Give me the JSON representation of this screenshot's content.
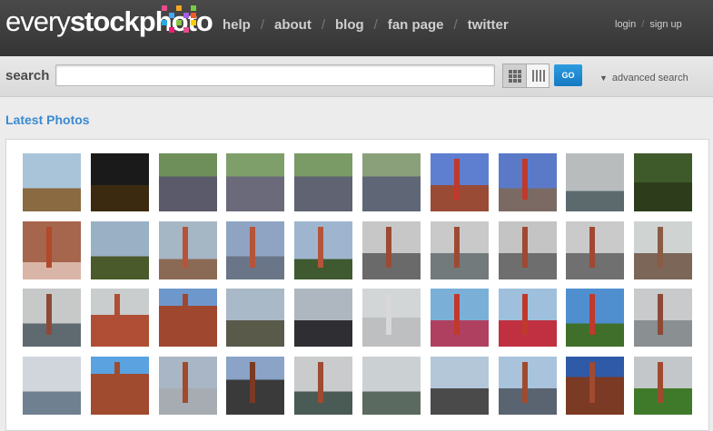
{
  "logo": {
    "light": "every",
    "bold": "stockphoto"
  },
  "nav": {
    "items": [
      "help",
      "about",
      "blog",
      "fan page",
      "twitter"
    ],
    "separator": "/"
  },
  "auth": {
    "login": "login",
    "signup": "sign up",
    "separator": "/"
  },
  "search": {
    "label": "search",
    "value": "",
    "placeholder": "",
    "go_label": "GO",
    "advanced_label": "advanced search"
  },
  "section": {
    "title": "Latest Photos"
  },
  "colors": {
    "header": "#3d3d3d",
    "accent": "#3a8ad1",
    "go": "#1a86d0"
  },
  "photos": [
    {
      "sky": "#a9c4d8",
      "ground": "#8a6a40",
      "split": 60,
      "accent": ""
    },
    {
      "sky": "#1a1a1a",
      "ground": "#3b2a10",
      "split": 55,
      "accent": ""
    },
    {
      "sky": "#6f8f5a",
      "ground": "#5a5a6a",
      "split": 40,
      "accent": ""
    },
    {
      "sky": "#7f9f6a",
      "ground": "#6a6a7a",
      "split": 40,
      "accent": ""
    },
    {
      "sky": "#7a9a66",
      "ground": "#5f6372",
      "split": 40,
      "accent": ""
    },
    {
      "sky": "#8aa07a",
      "ground": "#5f6676",
      "split": 40,
      "accent": ""
    },
    {
      "sky": "#5e7fd0",
      "ground": "#9a4b36",
      "split": 55,
      "accent": "#c0392b"
    },
    {
      "sky": "#5a7ac8",
      "ground": "#7b6a63",
      "split": 60,
      "accent": "#c0392b"
    },
    {
      "sky": "#b9bcbd",
      "ground": "#5c6a6e",
      "split": 65,
      "accent": ""
    },
    {
      "sky": "#3f5a2a",
      "ground": "#2d3d1c",
      "split": 50,
      "accent": ""
    },
    {
      "sky": "#a6654d",
      "ground": "#d9b5a7",
      "split": 70,
      "accent": "#b04a2a"
    },
    {
      "sky": "#9ab0c4",
      "ground": "#4a5a2a",
      "split": 60,
      "accent": ""
    },
    {
      "sky": "#a5b6c5",
      "ground": "#8b6a55",
      "split": 65,
      "accent": "#b5543a"
    },
    {
      "sky": "#8fa4c2",
      "ground": "#6a7688",
      "split": 60,
      "accent": "#b5543a"
    },
    {
      "sky": "#9fb5cf",
      "ground": "#3f5a30",
      "split": 65,
      "accent": "#b5543a"
    },
    {
      "sky": "#c7c7c7",
      "ground": "#6a6a6a",
      "split": 55,
      "accent": "#9a4a35"
    },
    {
      "sky": "#c9c9c9",
      "ground": "#727a7c",
      "split": 55,
      "accent": "#9e4a33"
    },
    {
      "sky": "#c4c4c4",
      "ground": "#6e6e6e",
      "split": 55,
      "accent": "#a04832"
    },
    {
      "sky": "#cacaca",
      "ground": "#707070",
      "split": 55,
      "accent": "#a04832"
    },
    {
      "sky": "#cfd3d2",
      "ground": "#7b6658",
      "split": 55,
      "accent": "#8a5b45"
    },
    {
      "sky": "#c7c8c8",
      "ground": "#5f6a70",
      "split": 60,
      "accent": "#8c4a36"
    },
    {
      "sky": "#c9cdcd",
      "ground": "#b04e35",
      "split": 45,
      "accent": "#b04e35"
    },
    {
      "sky": "#6e98cc",
      "ground": "#a0472f",
      "split": 30,
      "accent": "#a0472f"
    },
    {
      "sky": "#a9b9c8",
      "ground": "#5a5a4a",
      "split": 55,
      "accent": ""
    },
    {
      "sky": "#aeb7bf",
      "ground": "#2f2f33",
      "split": 55,
      "accent": ""
    },
    {
      "sky": "#d3d6d7",
      "ground": "#bdbfc0",
      "split": 50,
      "accent": "#d8d8d8"
    },
    {
      "sky": "#7ab0d8",
      "ground": "#b04060",
      "split": 55,
      "accent": "#c0392b"
    },
    {
      "sky": "#9fc0dd",
      "ground": "#c03040",
      "split": 55,
      "accent": "#c0392b"
    },
    {
      "sky": "#4f8fd0",
      "ground": "#3f6f2a",
      "split": 60,
      "accent": "#c0392b"
    },
    {
      "sky": "#c8cacb",
      "ground": "#8a8f91",
      "split": 55,
      "accent": "#8c4a36"
    },
    {
      "sky": "#d0d6dc",
      "ground": "#6f8090",
      "split": 60,
      "accent": ""
    },
    {
      "sky": "#5aa3e0",
      "ground": "#a04a30",
      "split": 30,
      "accent": "#a04a30"
    },
    {
      "sky": "#a9b6c6",
      "ground": "#a6acb2",
      "split": 55,
      "accent": "#a04a30"
    },
    {
      "sky": "#8aa3c7",
      "ground": "#3a3a3a",
      "split": 40,
      "accent": "#7a3a24"
    },
    {
      "sky": "#c9cbcc",
      "ground": "#4a5a55",
      "split": 60,
      "accent": "#a04a30"
    },
    {
      "sky": "#cbd0d3",
      "ground": "#5a6a60",
      "split": 60,
      "accent": ""
    },
    {
      "sky": "#b3c7d9",
      "ground": "#4a4a4a",
      "split": 55,
      "accent": ""
    },
    {
      "sky": "#a9c3dc",
      "ground": "#5a6470",
      "split": 55,
      "accent": "#a04a30"
    },
    {
      "sky": "#2f5aa8",
      "ground": "#7a3a24",
      "split": 35,
      "accent": "#a04a30"
    },
    {
      "sky": "#c4c7c9",
      "ground": "#3f7a2a",
      "split": 55,
      "accent": "#a04a30"
    }
  ]
}
